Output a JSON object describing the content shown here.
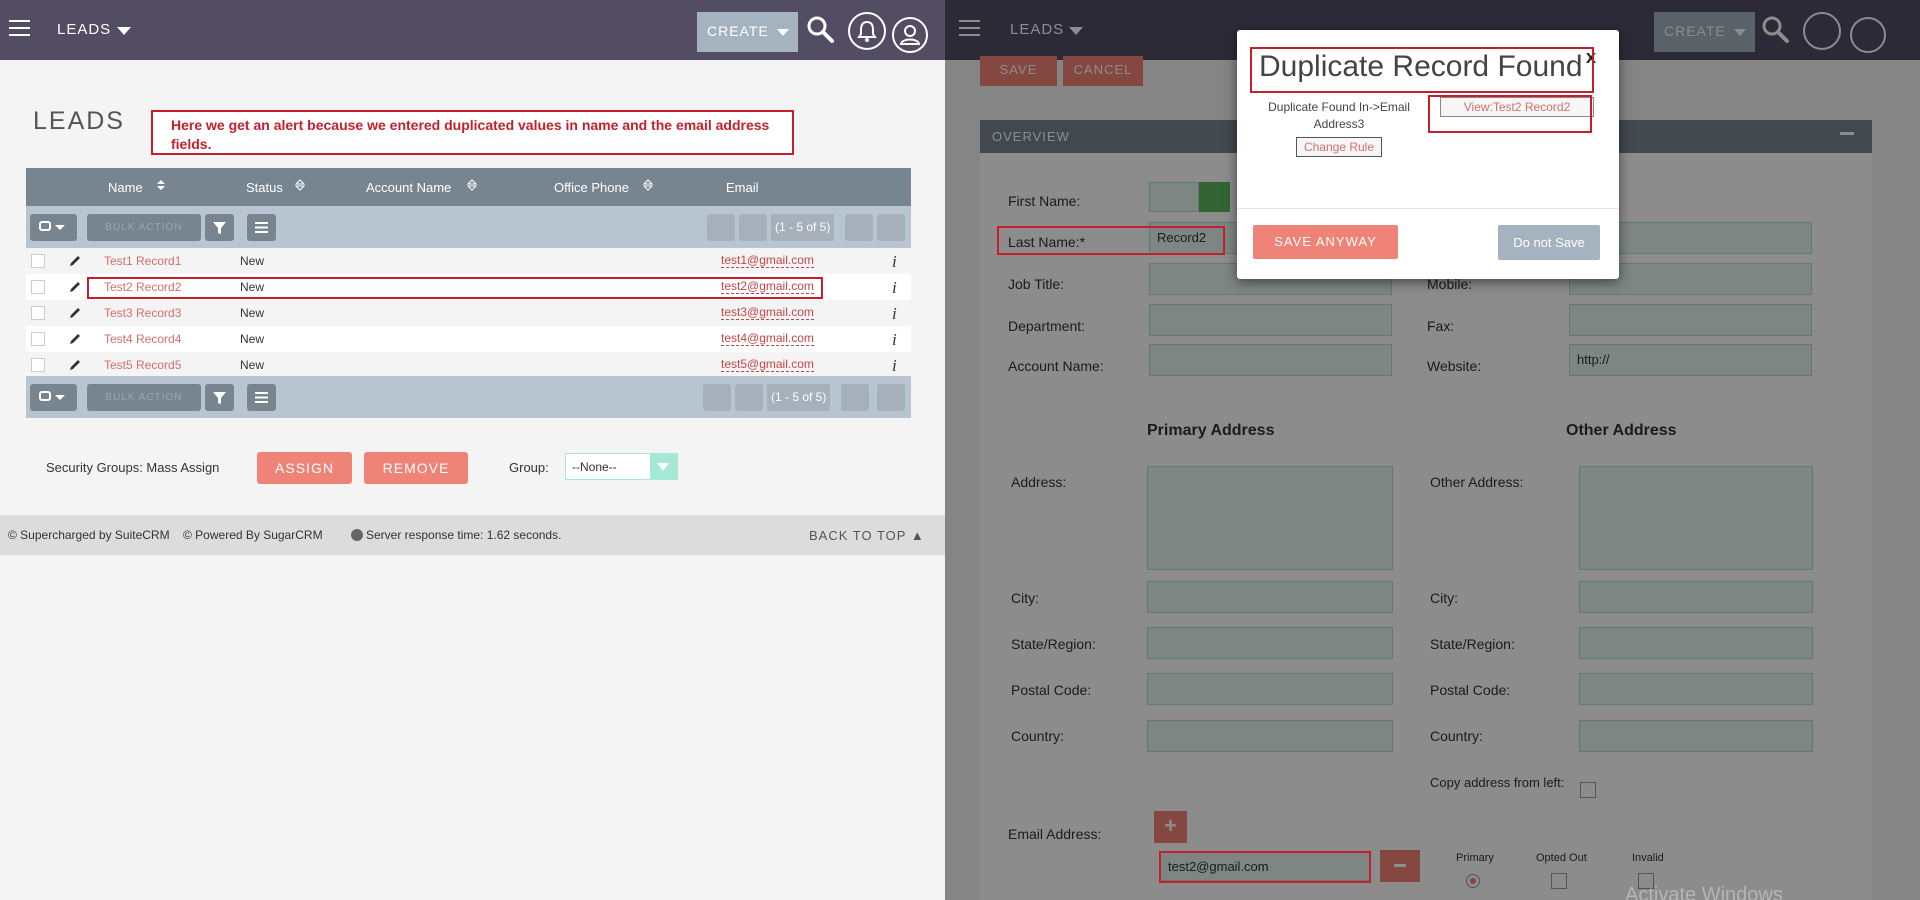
{
  "left": {
    "topbar": {
      "module": "LEADS",
      "create": "CREATE"
    },
    "heading": "LEADS",
    "annotation": "Here we get an alert because we entered duplicated values in name and the email address fields.",
    "columns": [
      "Name",
      "Status",
      "Account Name",
      "Office Phone",
      "Email"
    ],
    "bulk_label": "BULK ACTION",
    "pagination": "(1 - 5 of 5)",
    "rows": [
      {
        "name": "Test1 Record1",
        "status": "New",
        "email": "test1@gmail.com"
      },
      {
        "name": "Test2 Record2",
        "status": "New",
        "email": "test2@gmail.com"
      },
      {
        "name": "Test3 Record3",
        "status": "New",
        "email": "test3@gmail.com"
      },
      {
        "name": "Test4 Record4",
        "status": "New",
        "email": "test4@gmail.com"
      },
      {
        "name": "Test5 Record5",
        "status": "New",
        "email": "test5@gmail.com"
      }
    ],
    "info_glyph": "i",
    "security": {
      "label": "Security Groups: Mass Assign",
      "assign": "ASSIGN",
      "remove": "REMOVE",
      "group_label": "Group:",
      "group_value": "--None--"
    },
    "footer": {
      "suitecrm": "© Supercharged by SuiteCRM",
      "sugarcrm": "© Powered By SugarCRM",
      "response": "Server response time: 1.62 seconds.",
      "back_to_top": "BACK TO TOP"
    }
  },
  "right": {
    "topbar": {
      "module": "LEADS",
      "create": "CREATE"
    },
    "save": "SAVE",
    "cancel": "CANCEL",
    "panel_title": "OVERVIEW",
    "fields": {
      "first_name": "First Name:",
      "last_name": "Last Name:*",
      "last_name_value": "Record2",
      "job_title": "Job Title:",
      "mobile": "Mobile:",
      "department": "Department:",
      "fax": "Fax:",
      "account_name": "Account Name:",
      "website": "Website:",
      "website_value": "http://",
      "primary_address": "Primary Address",
      "other_address": "Other Address",
      "address": "Address:",
      "other_address_label": "Other Address:",
      "city": "City:",
      "state": "State/Region:",
      "postal": "Postal Code:",
      "country": "Country:",
      "copy_address": "Copy address from left:",
      "email": "Email Address:",
      "email_value": "test2@gmail.com",
      "primary": "Primary",
      "opted_out": "Opted Out",
      "invalid": "Invalid"
    },
    "watermark": "Activate Windows"
  },
  "modal": {
    "title": "Duplicate Record Found",
    "close": "x",
    "message": "Duplicate Found In->Email Address3",
    "view": "View:Test2 Record2",
    "change_rule": "Change Rule",
    "save_anyway": "SAVE ANYWAY",
    "do_not_save": "Do not Save"
  },
  "colors": {
    "topbar": "#534d64",
    "accent": "#f08377",
    "annotation": "#c51f2b",
    "input_bg": "#e4f5ef"
  }
}
